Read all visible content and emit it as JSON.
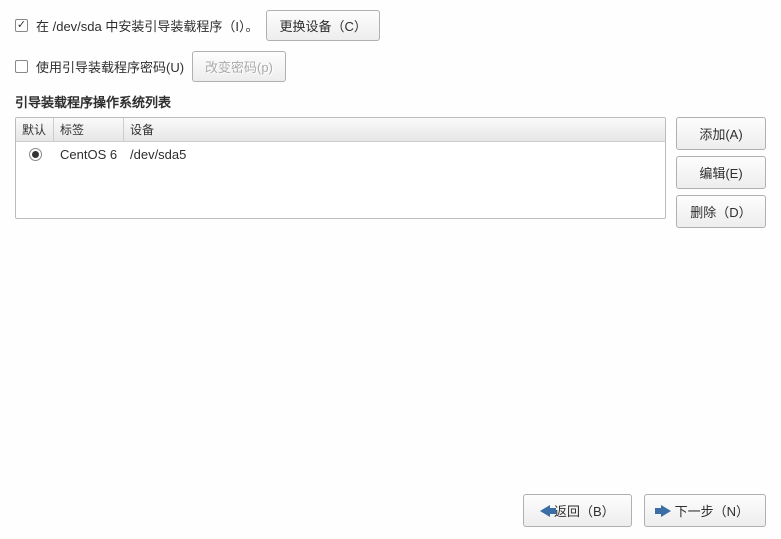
{
  "install_checkbox": {
    "checked": true,
    "label": "在 /dev/sda 中安装引导装载程序（I）。"
  },
  "change_device_btn": "更换设备（C）",
  "password_checkbox": {
    "checked": false,
    "label": "使用引导装载程序密码(U)"
  },
  "change_password_btn": "改变密码(p)",
  "section_title": "引导装载程序操作系统列表",
  "table": {
    "headers": {
      "default": "默认",
      "label": "标签",
      "device": "设备"
    },
    "rows": [
      {
        "selected": true,
        "label": "CentOS 6",
        "device": "/dev/sda5"
      }
    ]
  },
  "side_buttons": {
    "add": "添加(A)",
    "edit": "编辑(E)",
    "delete": "删除（D）"
  },
  "footer": {
    "back": "返回（B）",
    "next": "下一步（N）"
  }
}
